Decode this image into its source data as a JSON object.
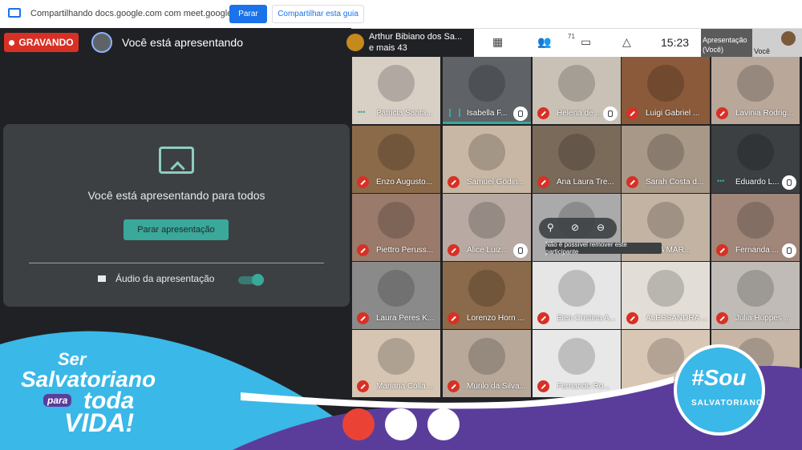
{
  "share_bar": {
    "text": "Compartilhando docs.google.com com meet.google.com",
    "stop_label": "Parar",
    "share_tab_label": "Compartilhar esta guia"
  },
  "left_panel": {
    "recording_label": "GRAVANDO",
    "presenting_label": "Você está apresentando",
    "card": {
      "title": "Você está apresentando para todos",
      "stop_button": "Parar apresentação",
      "audio_label": "Áudio da apresentação",
      "audio_on": true
    }
  },
  "top_bar": {
    "host_line1": "Arthur Bibiano dos Sa...",
    "host_line2": "e mais 43",
    "people_count": "71",
    "time": "15:23",
    "presentation_label_1": "Apresentação",
    "presentation_label_2": "(Você)",
    "self_label": "Você"
  },
  "tiles": [
    {
      "name": "Patricia Santa...",
      "badge": "dots",
      "hand": false,
      "bg": "#d8cfc5"
    },
    {
      "name": "Isabella F...",
      "badge": "speak",
      "hand": true,
      "bg": "#5f6368",
      "speaking": true
    },
    {
      "name": "Helena de ...",
      "badge": "mic-off",
      "hand": true,
      "bg": "#c9c1b6"
    },
    {
      "name": "Luigi Gabriel ...",
      "badge": "mic-off",
      "hand": false,
      "bg": "#8a5a3a"
    },
    {
      "name": "Lavinia Rodrig...",
      "badge": "mic-off",
      "hand": false,
      "bg": "#b9a79a"
    },
    {
      "name": "Enzo Augusto...",
      "badge": "mic-off",
      "hand": false,
      "bg": "#8b6a4a"
    },
    {
      "name": "Samuel Godin...",
      "badge": "mic-off",
      "hand": false,
      "bg": "#c7b7a4"
    },
    {
      "name": "Ana Laura Tre...",
      "badge": "mic-off",
      "hand": false,
      "bg": "#7a6a5a"
    },
    {
      "name": "Sarah Costa d...",
      "badge": "mic-off",
      "hand": false,
      "bg": "#a89888"
    },
    {
      "name": "Eduardo L...",
      "badge": "dots",
      "hand": true,
      "bg": "#3c4043"
    },
    {
      "name": "Piettro Peruss...",
      "badge": "mic-off",
      "hand": false,
      "bg": "#9a7a6a"
    },
    {
      "name": "Alice Luiz...",
      "badge": "mic-off",
      "hand": true,
      "bg": "#b8aaa2"
    },
    {
      "name": "",
      "badge": "none",
      "hand": false,
      "bg": "#aaaaaa"
    },
    {
      "name": "IANA MAR...",
      "badge": "none",
      "hand": false,
      "bg": "#c2b3a3"
    },
    {
      "name": "Fernanda ...",
      "badge": "mic-off",
      "hand": true,
      "bg": "#a0877a"
    },
    {
      "name": "Laura Peres K...",
      "badge": "mic-off",
      "hand": false,
      "bg": "#8a8a8a"
    },
    {
      "name": "Lorenzo Horn ...",
      "badge": "mic-off",
      "hand": false,
      "bg": "#8a6a4a"
    },
    {
      "name": "Elen Cristina A...",
      "badge": "mic-off",
      "hand": false,
      "bg": "#e6e6e6"
    },
    {
      "name": "ALESSANDRA ...",
      "badge": "mic-off",
      "hand": false,
      "bg": "#e2ddd6"
    },
    {
      "name": "Júlia Huppes ...",
      "badge": "mic-off",
      "hand": false,
      "bg": "#c0bbb6"
    },
    {
      "name": "Mariana Colla ...",
      "badge": "mic-off",
      "hand": false,
      "bg": "#d6c5b3"
    },
    {
      "name": "Murilo da Silva...",
      "badge": "mic-off",
      "hand": false,
      "bg": "#b7a89a"
    },
    {
      "name": "Fernando Ro...",
      "badge": "mic-off",
      "hand": false,
      "bg": "#e8e8e8"
    },
    {
      "name": "",
      "badge": "none",
      "hand": false,
      "bg": "#d9c7b5"
    },
    {
      "name": "",
      "badge": "none",
      "hand": false,
      "bg": "#c7b6a6"
    }
  ],
  "tooltip": "Não é possível remover este participante",
  "branding": {
    "ser": "Ser",
    "salvatoriano": "Salvatoriano",
    "para": "para",
    "toda": "toda",
    "vida": "VIDA!",
    "sou_line1": "#Sou",
    "sou_line2": "SALVATORIANO"
  },
  "colors": {
    "recording": "#d93025",
    "accent": "#3aa89a",
    "brand_blue": "#1a73e8",
    "wave_purple": "#5a3d9b",
    "wave_cyan": "#3ab8e8"
  }
}
